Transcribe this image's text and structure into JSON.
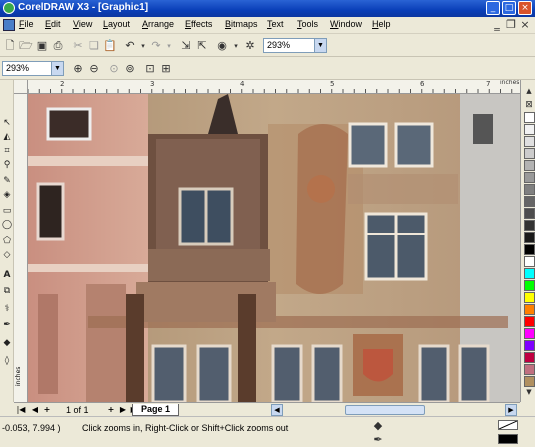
{
  "window": {
    "title": "CorelDRAW X3 - [Graphic1]",
    "controls": {
      "minimize": "_",
      "restore": "□",
      "close": "×"
    }
  },
  "menu": [
    "File",
    "Edit",
    "View",
    "Layout",
    "Arrange",
    "Effects",
    "Bitmaps",
    "Text",
    "Tools",
    "Window",
    "Help"
  ],
  "standard_toolbar": {
    "zoom_level": "293%",
    "icons": [
      "new-icon",
      "open-icon",
      "save-icon",
      "print-icon",
      "cut-icon",
      "copy-icon",
      "paste-icon",
      "undo-icon",
      "redo-icon",
      "import-icon",
      "export-icon",
      "application-launcher-icon",
      "welcome-screen-icon"
    ]
  },
  "zoom_toolbar": {
    "zoom_level": "293%",
    "icons": [
      "zoom-in-icon",
      "zoom-out-icon",
      "zoom-to-selected-icon",
      "zoom-to-all-objects-icon",
      "zoom-to-page-icon",
      "zoom-to-page-width-icon"
    ]
  },
  "ruler": {
    "units": "inches",
    "h_labels": [
      "2",
      "3",
      "4",
      "5",
      "6",
      "7"
    ],
    "v_labels": [
      "inches"
    ]
  },
  "toolbox": {
    "tools": [
      "pick-tool-icon",
      "shape-tool-icon",
      "crop-tool-icon",
      "zoom-tool-icon",
      "freehand-tool-icon",
      "smart-fill-icon",
      "rectangle-tool-icon",
      "ellipse-tool-icon",
      "polygon-tool-icon",
      "basic-shapes-icon",
      "text-tool-icon",
      "interactive-blend-icon",
      "eyedropper-tool-icon",
      "outline-tool-icon",
      "fill-tool-icon",
      "interactive-fill-icon"
    ]
  },
  "palette": {
    "colors": [
      "#ffffff",
      "#f2f2f2",
      "#e0e0e0",
      "#cccccc",
      "#b3b3b3",
      "#999999",
      "#808080",
      "#666666",
      "#4d4d4d",
      "#333333",
      "#1a1a1a",
      "#000000",
      "#ffffff",
      "#00ffff",
      "#00ff00",
      "#ffff00",
      "#ff8000",
      "#ff0000",
      "#ff00ff",
      "#8000ff",
      "#c00040",
      "#c07080",
      "#b09060"
    ]
  },
  "page_nav": {
    "page_count": "1 of 1",
    "tab_label": "Page 1"
  },
  "status": {
    "coordinates": "-0.053, 7.994 )",
    "hint": "Click zooms in, Right-Click or Shift+Click zooms out"
  }
}
